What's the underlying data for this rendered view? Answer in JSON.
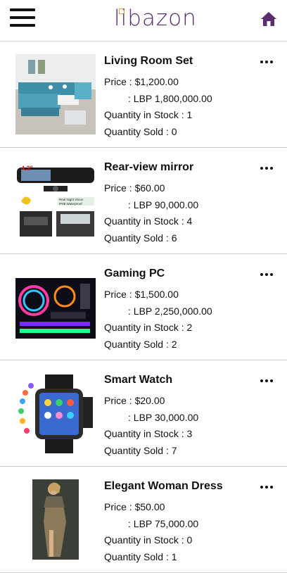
{
  "app": {
    "logo_text": "libazon",
    "accent_color": "#5a2d6e",
    "menu_icon": "hamburger-icon",
    "home_icon": "home-icon"
  },
  "labels": {
    "price": "Price : ",
    "lbp_prefix": ": LBP ",
    "stock": "Quantity in Stock : ",
    "sold": "Quantity Sold : "
  },
  "products": [
    {
      "name": "Living Room Set",
      "price": "$1,200.00",
      "lbp": "1,800,000.00",
      "stock": "1",
      "sold": "0",
      "image": "living-room-sofa"
    },
    {
      "name": "Rear-view mirror",
      "price": "$60.00",
      "lbp": "90,000.00",
      "stock": "4",
      "sold": "6",
      "image": "rear-view-mirror-camera",
      "image_text": [
        "4.3\"",
        "Real Night Vision",
        "IP68 Waterproof"
      ]
    },
    {
      "name": "Gaming PC",
      "price": "$1,500.00",
      "lbp": "2,250,000.00",
      "stock": "2",
      "sold": "2",
      "image": "gaming-pc-rgb"
    },
    {
      "name": "Smart Watch",
      "price": "$20.00",
      "lbp": "30,000.00",
      "stock": "3",
      "sold": "7",
      "image": "smart-watch"
    },
    {
      "name": "Elegant Woman Dress",
      "price": "$50.00",
      "lbp": "75,000.00",
      "stock": "0",
      "sold": "1",
      "image": "woman-dress"
    }
  ]
}
